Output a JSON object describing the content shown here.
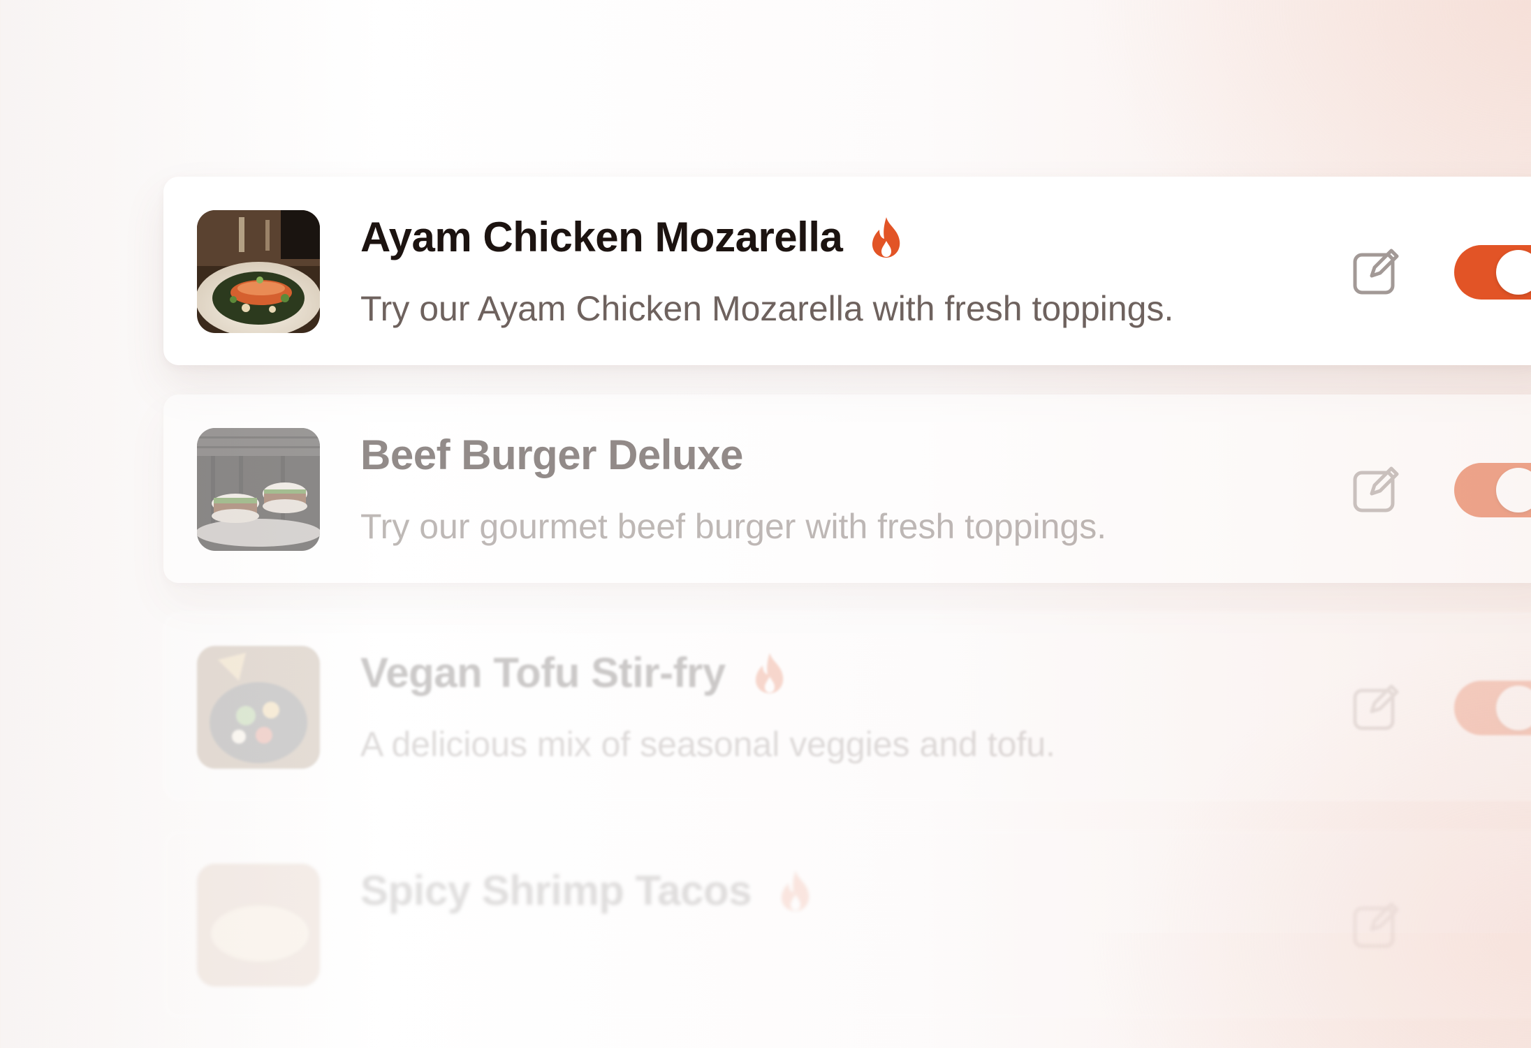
{
  "items": [
    {
      "title": "Ayam Chicken Mozarella",
      "description": "Try our Ayam Chicken Mozarella with fresh toppings.",
      "popular": true,
      "icon": "flame-icon",
      "enabled": true
    },
    {
      "title": "Beef Burger Deluxe",
      "description": "Try our gourmet beef burger with fresh toppings.",
      "popular": false,
      "enabled": true
    },
    {
      "title": "Vegan Tofu Stir-fry",
      "description": "A delicious mix of seasonal veggies and tofu.",
      "popular": true,
      "icon": "flame-icon",
      "enabled": true
    },
    {
      "title": "Spicy Shrimp Tacos",
      "description": "",
      "popular": true,
      "icon": "flame-icon",
      "enabled": true
    }
  ],
  "colors": {
    "accent": "#e25426",
    "title": "#1c1310",
    "description": "#6e625e",
    "edit_icon": "#a29996"
  }
}
